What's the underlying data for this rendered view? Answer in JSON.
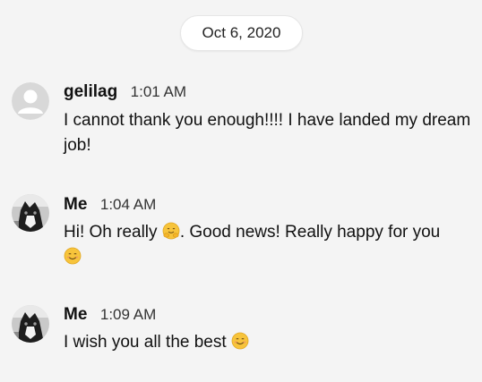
{
  "date_separator": "Oct 6, 2020",
  "messages": [
    {
      "sender": "gelilag",
      "time": "1:01 AM",
      "avatar": "default-user-avatar",
      "text_parts": [
        "I cannot thank you enough!!!! I have landed my dream job!"
      ]
    },
    {
      "sender": "Me",
      "time": "1:04 AM",
      "avatar": "cat-photo-avatar",
      "text_parts": [
        "Hi! Oh really ",
        ". Good news! Really happy for you"
      ],
      "emojis": [
        "hugging-face-emoji",
        "smiling-face-emoji"
      ]
    },
    {
      "sender": "Me",
      "time": "1:09 AM",
      "avatar": "cat-photo-avatar",
      "text_parts": [
        "I wish you all the best "
      ],
      "emojis": [
        "smiling-face-emoji"
      ]
    }
  ],
  "colors": {
    "background": "#f4f4f4",
    "pill_background": "#ffffff",
    "default_avatar": "#d8d8d8",
    "emoji_yellow": "#f7c43b"
  }
}
